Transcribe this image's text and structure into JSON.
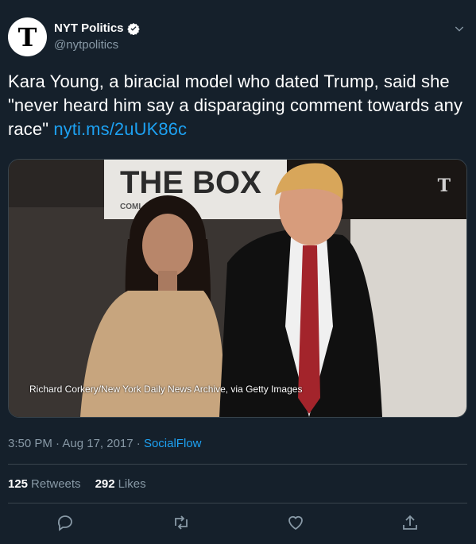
{
  "author": {
    "name": "NYT Politics",
    "handle": "@nytpolitics",
    "avatar_letter": "T",
    "verified": true
  },
  "tweet": {
    "text": "Kara Young, a biracial model who dated Trump, said she \"never heard him say a disparaging comment towards any race\"",
    "link": "nyti.ms/2uUK86c"
  },
  "media": {
    "sign_text": "THE BOX",
    "sign_subtext": "COMI",
    "watermark": "T",
    "credit": "Richard Corkery/New York Daily News Archive, via Getty Images"
  },
  "meta": {
    "timestamp": "3:50 PM · Aug 17, 2017 ·",
    "source": "SocialFlow"
  },
  "stats": {
    "retweets_count": "125",
    "retweets_label": "Retweets",
    "likes_count": "292",
    "likes_label": "Likes"
  },
  "colors": {
    "background": "#15202b",
    "accent": "#1da1f2",
    "muted": "#8899a6",
    "border": "#38444d"
  },
  "icons": [
    "verified-badge-icon",
    "chevron-down-icon",
    "reply-icon",
    "retweet-icon",
    "like-icon",
    "share-icon"
  ]
}
